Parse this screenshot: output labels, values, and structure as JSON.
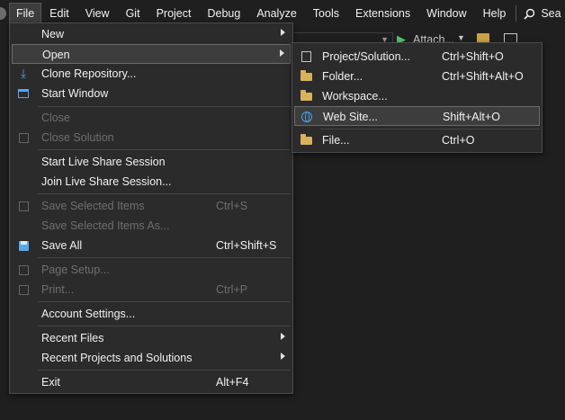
{
  "menubar": {
    "items": [
      "File",
      "Edit",
      "View",
      "Git",
      "Project",
      "Debug",
      "Analyze",
      "Tools",
      "Extensions",
      "Window",
      "Help"
    ],
    "search_label": "Sea"
  },
  "toolbar": {
    "attach_label": "Attach..."
  },
  "file_menu": {
    "items": [
      {
        "label": "New",
        "shortcut": "",
        "submenu": true,
        "disabled": false,
        "icon": ""
      },
      {
        "label": "Open",
        "shortcut": "",
        "submenu": true,
        "disabled": false,
        "icon": "",
        "highlighted": true
      },
      {
        "label": "Clone Repository...",
        "shortcut": "",
        "disabled": false,
        "icon": "download-icon"
      },
      {
        "label": "Start Window",
        "shortcut": "",
        "disabled": false,
        "icon": "start-window-icon"
      },
      {
        "label": "Close",
        "shortcut": "",
        "disabled": true,
        "icon": ""
      },
      {
        "label": "Close Solution",
        "shortcut": "",
        "disabled": true,
        "icon": "close-solution-icon"
      },
      {
        "label": "Start Live Share Session",
        "shortcut": "",
        "disabled": false,
        "icon": ""
      },
      {
        "label": "Join Live Share Session...",
        "shortcut": "",
        "disabled": false,
        "icon": ""
      },
      {
        "label": "Save Selected Items",
        "shortcut": "Ctrl+S",
        "disabled": true,
        "icon": "save-icon"
      },
      {
        "label": "Save Selected Items As...",
        "shortcut": "",
        "disabled": true,
        "icon": ""
      },
      {
        "label": "Save All",
        "shortcut": "Ctrl+Shift+S",
        "disabled": false,
        "icon": "save-all-icon"
      },
      {
        "label": "Page Setup...",
        "shortcut": "",
        "disabled": true,
        "icon": "page-setup-icon"
      },
      {
        "label": "Print...",
        "shortcut": "Ctrl+P",
        "disabled": true,
        "icon": "print-icon"
      },
      {
        "label": "Account Settings...",
        "shortcut": "",
        "disabled": false,
        "icon": ""
      },
      {
        "label": "Recent Files",
        "shortcut": "",
        "submenu": true,
        "disabled": false,
        "icon": ""
      },
      {
        "label": "Recent Projects and Solutions",
        "shortcut": "",
        "submenu": true,
        "disabled": false,
        "icon": ""
      },
      {
        "label": "Exit",
        "shortcut": "Alt+F4",
        "disabled": false,
        "icon": ""
      }
    ]
  },
  "open_menu": {
    "items": [
      {
        "label": "Project/Solution...",
        "shortcut": "Ctrl+Shift+O",
        "icon": "project-solution-icon"
      },
      {
        "label": "Folder...",
        "shortcut": "Ctrl+Shift+Alt+O",
        "icon": "folder-icon"
      },
      {
        "label": "Workspace...",
        "shortcut": "",
        "icon": "workspace-icon"
      },
      {
        "label": "Web Site...",
        "shortcut": "Shift+Alt+O",
        "icon": "globe-icon",
        "highlighted": true
      },
      {
        "label": "File...",
        "shortcut": "Ctrl+O",
        "icon": "file-open-icon"
      }
    ]
  }
}
